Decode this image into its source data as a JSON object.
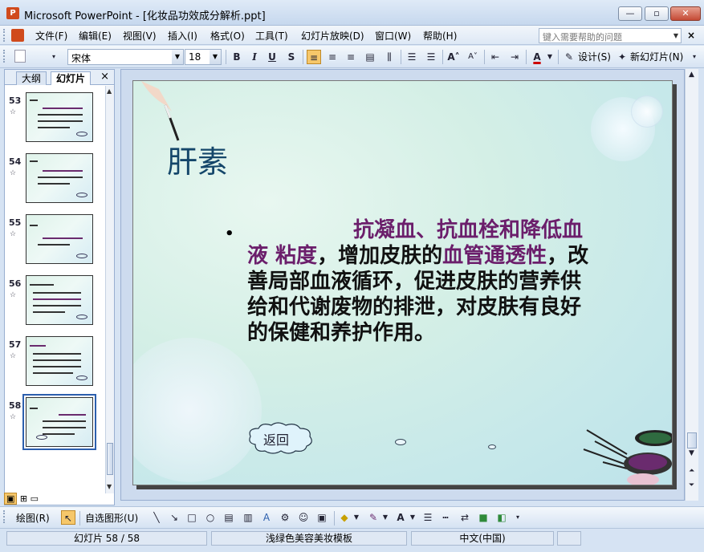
{
  "window": {
    "title": "Microsoft PowerPoint - [化妆品功效成分解析.ppt]",
    "controls": {
      "minimize": "—",
      "restore": "▫",
      "close": "✕"
    }
  },
  "menu": {
    "items": [
      "文件(F)",
      "编辑(E)",
      "视图(V)",
      "插入(I)",
      "格式(O)",
      "工具(T)",
      "幻灯片放映(D)",
      "窗口(W)",
      "帮助(H)"
    ],
    "help_placeholder": "键入需要帮助的问题",
    "close": "×"
  },
  "toolbar": {
    "font": "宋体",
    "size": "18",
    "bold": "B",
    "italic": "I",
    "underline": "U",
    "shadow": "S",
    "font_color_glyph": "A",
    "design_label": "设计(S)",
    "new_slide_label": "新幻灯片(N)"
  },
  "left_panel": {
    "tabs": [
      "大纲",
      "幻灯片"
    ],
    "active_tab": "幻灯片",
    "close": "×",
    "thumbnails": [
      {
        "number": "53"
      },
      {
        "number": "54"
      },
      {
        "number": "55"
      },
      {
        "number": "56"
      },
      {
        "number": "57"
      },
      {
        "number": "58",
        "selected": true
      }
    ]
  },
  "slide": {
    "title": "肝素",
    "bullet": "•",
    "body_parts": [
      {
        "text": "抗凝血、抗血栓和降低血液 粘度",
        "highlight": true
      },
      {
        "text": "，增加皮肤的",
        "highlight": false
      },
      {
        "text": "血管通透性",
        "highlight": true
      },
      {
        "text": "，改善局部血液循环，促进皮肤的营养供给和代谢废物的排泄，对皮肤有良好的保健和养护作用。",
        "highlight": false
      }
    ],
    "return_button": "返回",
    "colors": {
      "title": "#14466a",
      "highlight": "#6b1e6b",
      "body": "#111111"
    }
  },
  "drawing_toolbar": {
    "draw_label": "绘图(R)",
    "autoshapes_label": "自选图形(U)"
  },
  "status": {
    "slide_info": "幻灯片 58 / 58",
    "template": "浅绿色美容美妆模板",
    "language": "中文(中国)"
  }
}
